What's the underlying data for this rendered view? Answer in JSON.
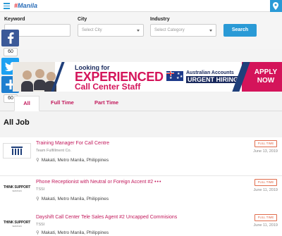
{
  "topbar": {
    "logo_hash": "#",
    "logo_text": "Manila"
  },
  "search": {
    "keyword_label": "Keyword",
    "city_label": "City",
    "city_placeholder": "Select City",
    "industry_label": "Industry",
    "industry_placeholder": "Select Category",
    "button_label": "Search"
  },
  "share": {
    "facebook_count": "60",
    "twitter_count": "60"
  },
  "banner": {
    "line1": "Looking for",
    "line2": "EXPERIENCED",
    "line3": "Call Center Staff",
    "aa_line1": "Australian Accounts",
    "aa_line2": "URGENT HIRING",
    "cta": "APPLY NOW"
  },
  "tabs": [
    {
      "label": "All"
    },
    {
      "label": "Full Time"
    },
    {
      "label": "Part Time"
    }
  ],
  "section_title": "All Job",
  "jobs": [
    {
      "title": "Training Manager For Call Centre",
      "company": "Team Fulfillment Co.",
      "location": "Makati, Metro Manila, Philippines",
      "type": "FULL TIME",
      "date": "June 13, 2019"
    },
    {
      "title": "Phone Receptionist with Neutral or Foreign Accent #2",
      "company": "TSSI",
      "location": "Makati, Metro Manila, Philippines",
      "type": "FULL TIME",
      "date": "June 11, 2019"
    },
    {
      "title": "Dayshift Call Center Tele Sales Agent #2 Uncapped Commisions",
      "company": "TSSI",
      "location": "Makati, Metro Manila, Philippines",
      "type": "FULL TIME",
      "date": "June 11, 2019"
    }
  ],
  "logos": {
    "think_main": "THINK SUPPORT",
    "think_sub": "SERVICES"
  }
}
